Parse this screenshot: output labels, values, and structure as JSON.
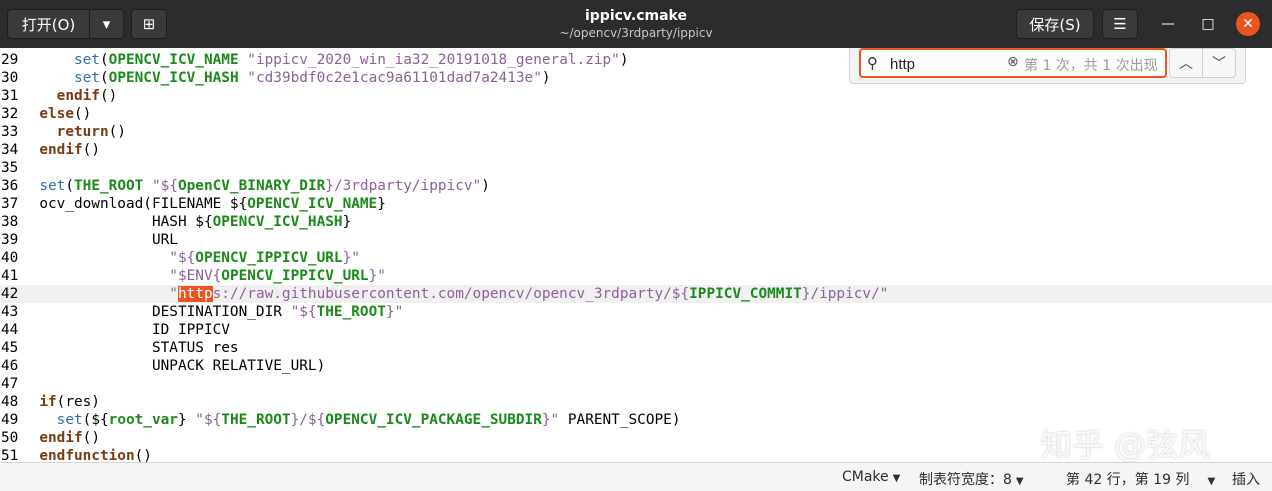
{
  "header": {
    "open_label": "打开(O)",
    "title": "ippicv.cmake",
    "subtitle": "~/opencv/3rdparty/ippicv",
    "save_label": "保存(S)"
  },
  "search": {
    "query": "http",
    "match_status": "第 1 次，共 1 次出现"
  },
  "editor": {
    "current_line": 42,
    "lines": [
      {
        "num": "29",
        "segments": [
          {
            "t": "    "
          },
          {
            "t": "set",
            "c": "fn"
          },
          {
            "t": "("
          },
          {
            "t": "OPENCV_ICV_NAME",
            "c": "var"
          },
          {
            "t": " "
          },
          {
            "t": "\"ippicv_2020_win_ia32_20191018_general.zip\"",
            "c": "str"
          },
          {
            "t": ")"
          }
        ]
      },
      {
        "num": "30",
        "segments": [
          {
            "t": "    "
          },
          {
            "t": "set",
            "c": "fn"
          },
          {
            "t": "("
          },
          {
            "t": "OPENCV_ICV_HASH",
            "c": "var"
          },
          {
            "t": " "
          },
          {
            "t": "\"cd39bdf0c2e1cac9a61101dad7a2413e\"",
            "c": "str"
          },
          {
            "t": ")"
          }
        ]
      },
      {
        "num": "31",
        "segments": [
          {
            "t": "  "
          },
          {
            "t": "endif",
            "c": "bold"
          },
          {
            "t": "()"
          }
        ]
      },
      {
        "num": "32",
        "segments": [
          {
            "t": ""
          },
          {
            "t": "else",
            "c": "bold"
          },
          {
            "t": "()"
          }
        ]
      },
      {
        "num": "33",
        "segments": [
          {
            "t": "  "
          },
          {
            "t": "return",
            "c": "bold"
          },
          {
            "t": "()"
          }
        ]
      },
      {
        "num": "34",
        "segments": [
          {
            "t": ""
          },
          {
            "t": "endif",
            "c": "bold"
          },
          {
            "t": "()"
          }
        ]
      },
      {
        "num": "35",
        "segments": []
      },
      {
        "num": "36",
        "segments": [
          {
            "t": ""
          },
          {
            "t": "set",
            "c": "fn"
          },
          {
            "t": "("
          },
          {
            "t": "THE_ROOT",
            "c": "var"
          },
          {
            "t": " "
          },
          {
            "t": "\"${",
            "c": "str"
          },
          {
            "t": "OpenCV_BINARY_DIR",
            "c": "var"
          },
          {
            "t": "}/3rdparty/ippicv\"",
            "c": "str"
          },
          {
            "t": ")"
          }
        ]
      },
      {
        "num": "37",
        "segments": [
          {
            "t": "ocv_download(FILENAME ${"
          },
          {
            "t": "OPENCV_ICV_NAME",
            "c": "var"
          },
          {
            "t": "}"
          }
        ]
      },
      {
        "num": "38",
        "segments": [
          {
            "t": "             HASH ${"
          },
          {
            "t": "OPENCV_ICV_HASH",
            "c": "var"
          },
          {
            "t": "}"
          }
        ]
      },
      {
        "num": "39",
        "segments": [
          {
            "t": "             URL"
          }
        ]
      },
      {
        "num": "40",
        "segments": [
          {
            "t": "               "
          },
          {
            "t": "\"${",
            "c": "str"
          },
          {
            "t": "OPENCV_IPPICV_URL",
            "c": "var"
          },
          {
            "t": "}\"",
            "c": "str"
          }
        ]
      },
      {
        "num": "41",
        "segments": [
          {
            "t": "               "
          },
          {
            "t": "\"$ENV{",
            "c": "str"
          },
          {
            "t": "OPENCV_IPPICV_URL",
            "c": "var"
          },
          {
            "t": "}\"",
            "c": "str"
          }
        ]
      },
      {
        "num": "42",
        "segments": [
          {
            "t": "               "
          },
          {
            "t": "\"",
            "c": "str"
          },
          {
            "t": "http",
            "c": "match"
          },
          {
            "t": "s://raw.githubusercontent.com/opencv/opencv_3rdparty/${",
            "c": "str"
          },
          {
            "t": "IPPICV_COMMIT",
            "c": "var"
          },
          {
            "t": "}/ippicv/\"",
            "c": "str"
          }
        ]
      },
      {
        "num": "43",
        "segments": [
          {
            "t": "             DESTINATION_DIR "
          },
          {
            "t": "\"${",
            "c": "str"
          },
          {
            "t": "THE_ROOT",
            "c": "var"
          },
          {
            "t": "}\"",
            "c": "str"
          }
        ]
      },
      {
        "num": "44",
        "segments": [
          {
            "t": "             ID IPPICV"
          }
        ]
      },
      {
        "num": "45",
        "segments": [
          {
            "t": "             STATUS res"
          }
        ]
      },
      {
        "num": "46",
        "segments": [
          {
            "t": "             UNPACK RELATIVE_URL)"
          }
        ]
      },
      {
        "num": "47",
        "segments": []
      },
      {
        "num": "48",
        "segments": [
          {
            "t": ""
          },
          {
            "t": "if",
            "c": "bold"
          },
          {
            "t": "(res)"
          }
        ]
      },
      {
        "num": "49",
        "segments": [
          {
            "t": "  "
          },
          {
            "t": "set",
            "c": "fn"
          },
          {
            "t": "(${"
          },
          {
            "t": "root_var",
            "c": "var"
          },
          {
            "t": "} "
          },
          {
            "t": "\"${",
            "c": "str"
          },
          {
            "t": "THE_ROOT",
            "c": "var"
          },
          {
            "t": "}/${",
            "c": "str"
          },
          {
            "t": "OPENCV_ICV_PACKAGE_SUBDIR",
            "c": "var"
          },
          {
            "t": "}\"",
            "c": "str"
          },
          {
            "t": " PARENT_SCOPE)"
          }
        ]
      },
      {
        "num": "50",
        "segments": [
          {
            "t": ""
          },
          {
            "t": "endif",
            "c": "bold"
          },
          {
            "t": "()"
          }
        ]
      },
      {
        "num": "51",
        "segments": [
          {
            "t": ""
          },
          {
            "t": "endfunction",
            "c": "bold"
          },
          {
            "t": "()"
          }
        ]
      }
    ]
  },
  "statusbar": {
    "language": "CMake",
    "tab_width": "制表符宽度：8",
    "position": "第 42 行，第 19 列",
    "insert_mode": "插入"
  },
  "watermark": "知乎 @弦风"
}
